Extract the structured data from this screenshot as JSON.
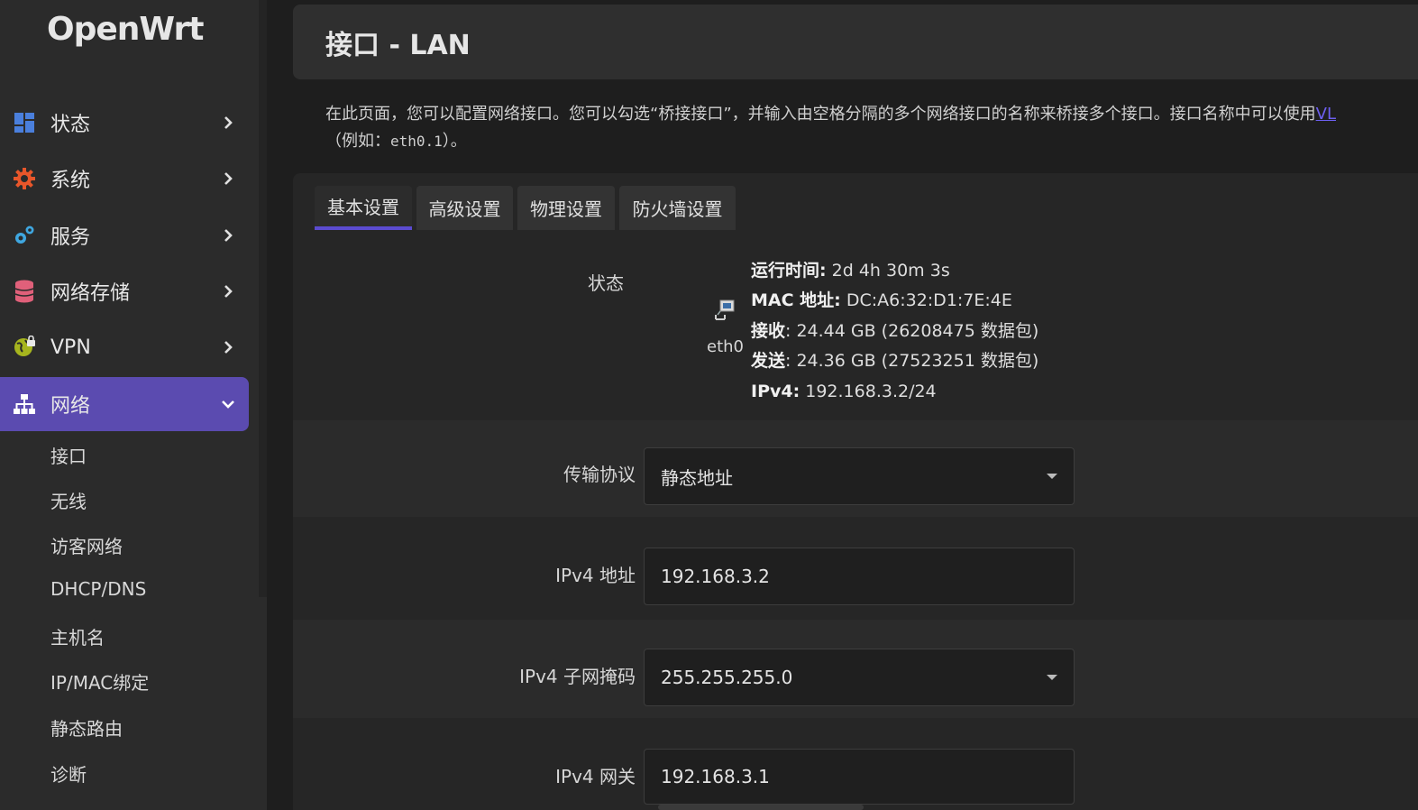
{
  "brand": {
    "logo": "OpenWrt"
  },
  "sidebar": {
    "items": [
      {
        "label": "状态",
        "icon": "dashboard-icon",
        "color": "#4a7fdc"
      },
      {
        "label": "系统",
        "icon": "gear-icon",
        "color": "#e8562a"
      },
      {
        "label": "服务",
        "icon": "gears-icon",
        "color": "#3fa7e0"
      },
      {
        "label": "网络存储",
        "icon": "database-icon",
        "color": "#e0607a"
      },
      {
        "label": "VPN",
        "icon": "globe-lock-icon",
        "color": "#a6b51e"
      },
      {
        "label": "网络",
        "icon": "network-icon",
        "color": "#ffffff"
      }
    ],
    "network_sub": [
      "接口",
      "无线",
      "访客网络",
      "DHCP/DNS",
      "主机名",
      "IP/MAC绑定",
      "静态路由",
      "诊断"
    ]
  },
  "page": {
    "title": "接口 - LAN",
    "desc_line1": "在此页面，您可以配置网络接口。您可以勾选“桥接接口”，并输入由空格分隔的多个网络接口的名称来桥接多个接口。接口名称中可以使用",
    "desc_link": "VL",
    "desc_line2_pre": "（例如：",
    "desc_line2_code": "eth0.1",
    "desc_line2_post": "）。"
  },
  "tabs": [
    "基本设置",
    "高级设置",
    "物理设置",
    "防火墙设置"
  ],
  "status": {
    "label": "状态",
    "device": "eth0",
    "uptime_key": "运行时间:",
    "uptime": " 2d 4h 30m 3s",
    "mac_key": "MAC 地址:",
    "mac": " DC:A6:32:D1:7E:4E",
    "rx_key": "接收",
    "rx": ": 24.44 GB (26208475 数据包)",
    "tx_key": "发送",
    "tx": ": 24.36 GB (27523251 数据包)",
    "ipv4_key": "IPv4:",
    "ipv4": " 192.168.3.2/24"
  },
  "form": {
    "protocol_label": "传输协议",
    "protocol_value": "静态地址",
    "ipv4_addr_label": "IPv4 地址",
    "ipv4_addr_value": "192.168.3.2",
    "netmask_label": "IPv4 子网掩码",
    "netmask_value": "255.255.255.0",
    "gateway_label": "IPv4 网关",
    "gateway_value": "192.168.3.1"
  },
  "colors": {
    "accent": "#5b4bb0",
    "tab_underline": "#5b4bd0",
    "link": "#6d5ff0"
  }
}
